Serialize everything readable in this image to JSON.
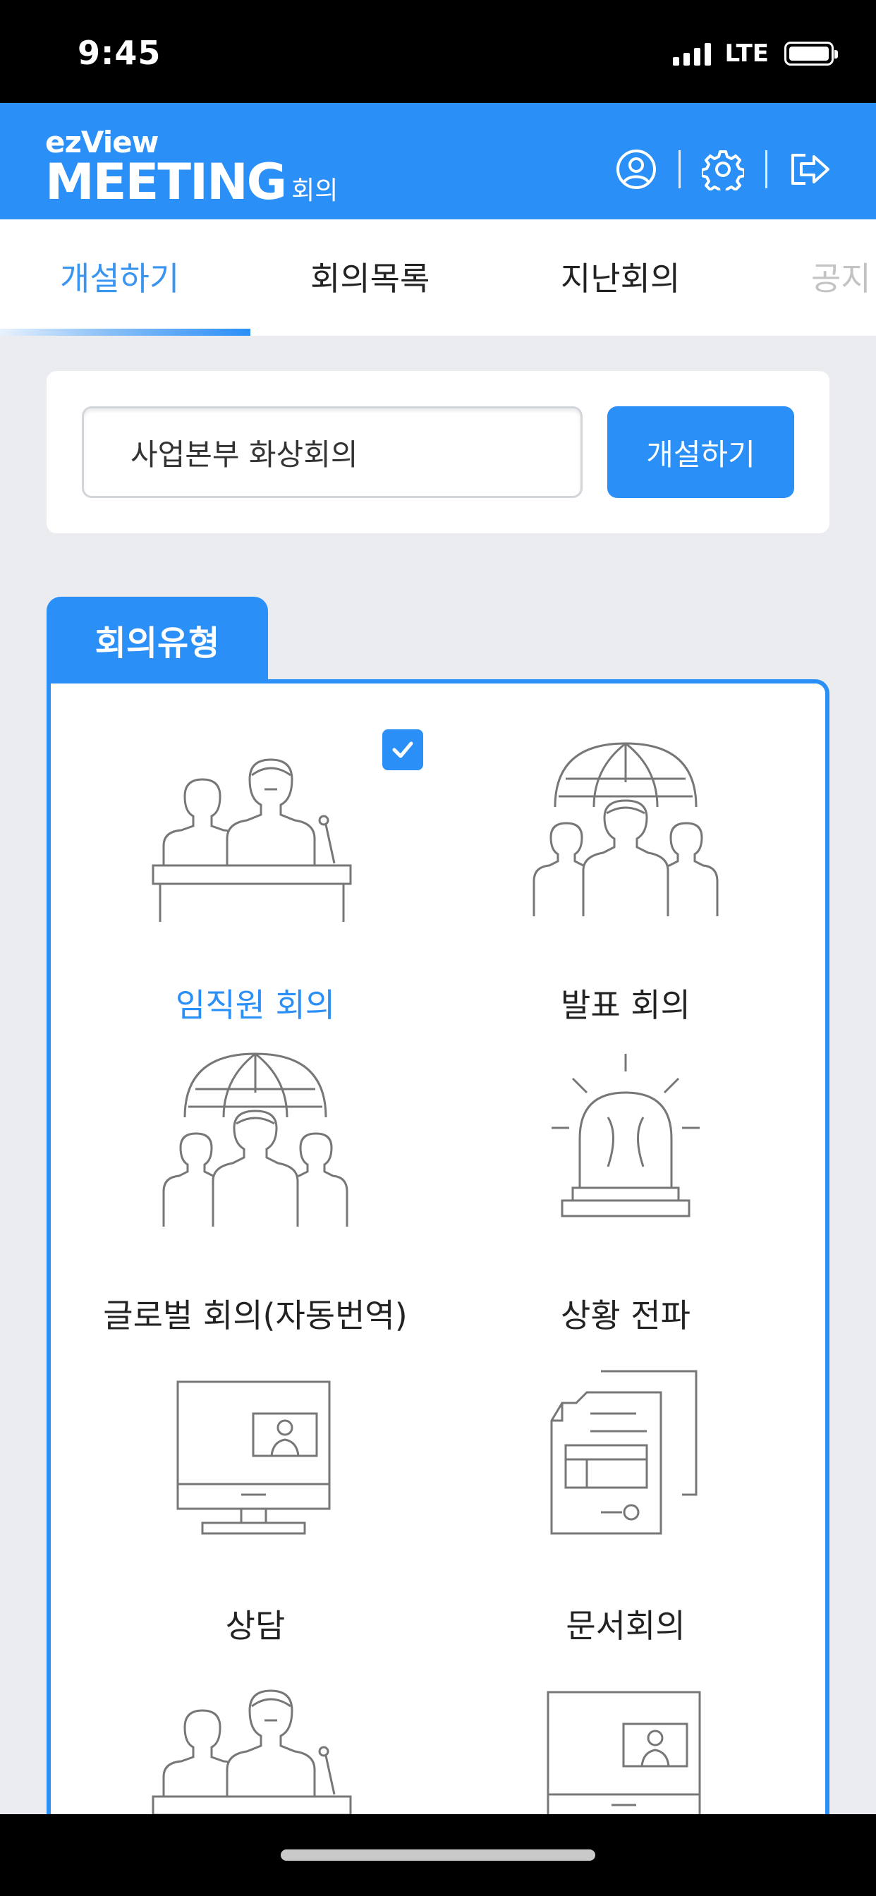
{
  "status_bar": {
    "time": "9:45",
    "network": "LTE"
  },
  "header": {
    "logo_top": "ezView",
    "logo_main": "MEETING",
    "logo_sub": "회의",
    "icons": [
      "profile-icon",
      "settings-icon",
      "logout-icon"
    ]
  },
  "tabs": [
    {
      "label": "개설하기",
      "active": true
    },
    {
      "label": "회의목록",
      "active": false
    },
    {
      "label": "지난회의",
      "active": false
    },
    {
      "label": "공지",
      "active": false
    }
  ],
  "create": {
    "input_value": "사업본부 화상회의",
    "button_label": "개설하기"
  },
  "meeting_types": {
    "section_title": "회의유형",
    "items": [
      {
        "label": "임직원 회의",
        "icon": "podium-speakers-icon",
        "selected": true
      },
      {
        "label": "발표 회의",
        "icon": "globe-group-icon",
        "selected": false
      },
      {
        "label": "글로벌 회의(자동번역)",
        "icon": "globe-group-icon",
        "selected": false
      },
      {
        "label": "상황 전파",
        "icon": "siren-icon",
        "selected": false
      },
      {
        "label": "상담",
        "icon": "monitor-video-icon",
        "selected": false
      },
      {
        "label": "문서회의",
        "icon": "documents-icon",
        "selected": false
      },
      {
        "label": "",
        "icon": "podium-speakers-icon",
        "selected": false
      },
      {
        "label": "",
        "icon": "monitor-video-icon",
        "selected": false
      }
    ]
  },
  "colors": {
    "accent": "#2a8ff7",
    "background": "#eaecef"
  }
}
